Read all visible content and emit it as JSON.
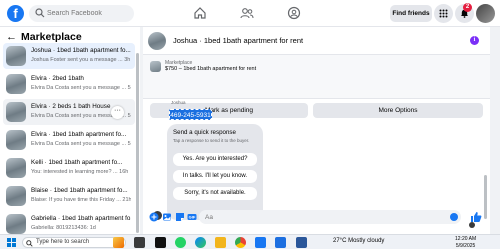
{
  "topbar": {
    "logo": "f",
    "search_placeholder": "Search Facebook",
    "find_friends": "Find friends",
    "notification_count": "2"
  },
  "sidebar": {
    "title": "Marketplace",
    "back": "←",
    "conversations": [
      {
        "name": "Joshua · 1bed 1bath apartment fo...",
        "snippet": "Joshua Foster sent you a message ...  3h"
      },
      {
        "name": "Elvira · 2bed 1bath",
        "snippet": "Elvira Da Costa sent you a message ...  5h"
      },
      {
        "name": "Elvira · 2 beds 1 bath House",
        "snippet": "Elvira Da Costa sent you a message ...  5h"
      },
      {
        "name": "Elvira · 1bed 1bath apartment fo...",
        "snippet": "Elvira Da Costa sent you a message ...  5h"
      },
      {
        "name": "Kelli · 1bed 1bath apartment fo...",
        "snippet": "You: interested in learning more? ...  16h"
      },
      {
        "name": "Blaise · 1bed 1bath apartment fo...",
        "snippet": "Blaise: If you have time this Friday ...  21h"
      },
      {
        "name": "Gabriella · 1bed 1bath apartment fo...",
        "snippet": "Gabriella: 8019213436: 1d"
      }
    ],
    "more": "···"
  },
  "chat": {
    "title": "Joshua · 1bed 1bath apartment for rent",
    "listing_label": "Marketplace",
    "listing_price": "$750 – 1bed 1bath apartment for rent",
    "mark_pending": "Mark as pending",
    "more_options": "More Options",
    "sender_label": "Joshua",
    "phone": "469-245-5931",
    "quick_response_title": "Send a quick response",
    "quick_response_sub": "Tap a response to send it to the buyer.",
    "quick_responses": [
      "Yes. Are you interested?",
      "In talks. I'll let you know.",
      "Sorry, it's not available."
    ],
    "composer_placeholder": "Aa"
  },
  "taskbar": {
    "search_placeholder": "Type here to search",
    "weather": "27°C  Mostly cloudy",
    "time": "12:20 AM",
    "date": "5/9/2025"
  },
  "colors": {
    "brand": "#1877f2",
    "badge": "#e41e3f",
    "info": "#7b2ff7"
  }
}
